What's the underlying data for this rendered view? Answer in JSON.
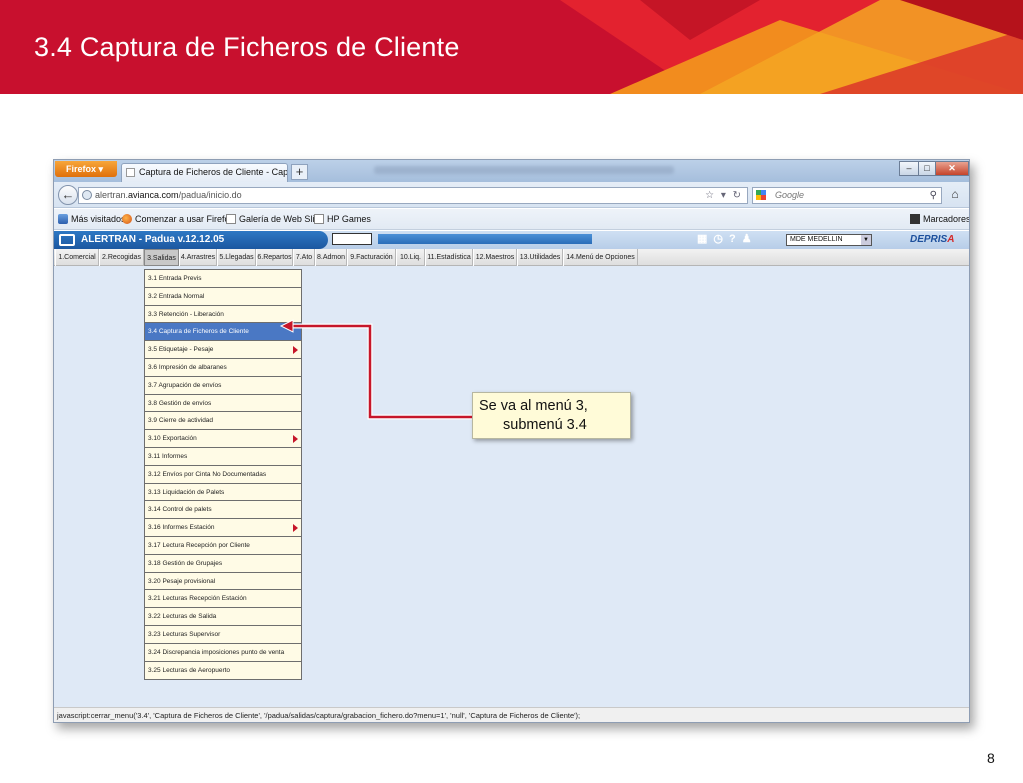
{
  "slide": {
    "title": "3.4 Captura de Ficheros de Cliente",
    "page_number": "8",
    "callout_line1": "Se va al menú 3,",
    "callout_line2": "submenú 3.4"
  },
  "browser": {
    "firefox_label": "Firefox",
    "tab_title": "Captura de Ficheros de Cliente - Captura...",
    "newtab_label": "+",
    "url_prefix": "alertran.",
    "url_domain": "avianca.com",
    "url_path": "/padua/inicio.do",
    "search_placeholder": "Google",
    "bookmarks": [
      {
        "label": "Más visitados"
      },
      {
        "label": "Comenzar a usar Firefox"
      },
      {
        "label": "Galería de Web Slice"
      },
      {
        "label": "HP Games"
      }
    ],
    "bookmarks_menu_label": "Marcadores",
    "status_text": "javascript:cerrar_menu('3.4', 'Captura de Ficheros de Cliente', '/padua/salidas/captura/grabacion_fichero.do?menu=1', 'null', 'Captura de Ficheros de Cliente');"
  },
  "app": {
    "title": "ALERTRAN - Padua  v.12.12.05",
    "branch_select": "MDE MEDELLIN",
    "brand_part1": "DEPRIS",
    "brand_part2": "A",
    "menu": [
      "1.Comercial",
      "2.Recogidas",
      "3.Salidas",
      "4.Arrastres",
      "5.Llegadas",
      "6.Repartos",
      "7.Ato",
      "8.Admon",
      "9.Facturación",
      "10.Liq.",
      "11.Estadística",
      "12.Maestros",
      "13.Utilidades",
      "14.Menú de Opciones"
    ],
    "active_menu_index": 2,
    "submenu": [
      {
        "label": "3.1 Entrada Previs",
        "has_sub": false
      },
      {
        "label": "3.2 Entrada Normal",
        "has_sub": false
      },
      {
        "label": "3.3 Retención - Liberación",
        "has_sub": false
      },
      {
        "label": "3.4 Captura de Ficheros de Cliente",
        "has_sub": false,
        "selected": true
      },
      {
        "label": "3.5 Etiquetaje - Pesaje",
        "has_sub": true
      },
      {
        "label": "3.6 Impresión de albaranes",
        "has_sub": false
      },
      {
        "label": "3.7 Agrupación de envíos",
        "has_sub": false
      },
      {
        "label": "3.8 Gestión de envíos",
        "has_sub": false
      },
      {
        "label": "3.9 Cierre de actividad",
        "has_sub": false
      },
      {
        "label": "3.10 Exportación",
        "has_sub": true
      },
      {
        "label": "3.11 Informes",
        "has_sub": false
      },
      {
        "label": "3.12 Envíos por Cinta No Documentadas",
        "has_sub": false
      },
      {
        "label": "3.13 Liquidación de Palets",
        "has_sub": false
      },
      {
        "label": "3.14 Control de palets",
        "has_sub": false
      },
      {
        "label": "3.16 Informes Estación",
        "has_sub": true
      },
      {
        "label": "3.17 Lectura Recepción por Cliente",
        "has_sub": false
      },
      {
        "label": "3.18 Gestión de Grupajes",
        "has_sub": false
      },
      {
        "label": "3.20 Pesaje provisional",
        "has_sub": false
      },
      {
        "label": "3.21 Lecturas Recepción Estación",
        "has_sub": false
      },
      {
        "label": "3.22 Lecturas de Salida",
        "has_sub": false
      },
      {
        "label": "3.23 Lecturas Supervisor",
        "has_sub": false
      },
      {
        "label": "3.24 Discrepancia imposiciones punto de venta",
        "has_sub": false
      },
      {
        "label": "3.25 Lecturas de Aeropuerto",
        "has_sub": false
      }
    ]
  },
  "colors": {
    "header_red": "#c8102e",
    "header_orange": "#f28c1e",
    "selected_item": "#4a78c4",
    "arrow": "#c6162a",
    "menu_background": "#fffbe6"
  }
}
